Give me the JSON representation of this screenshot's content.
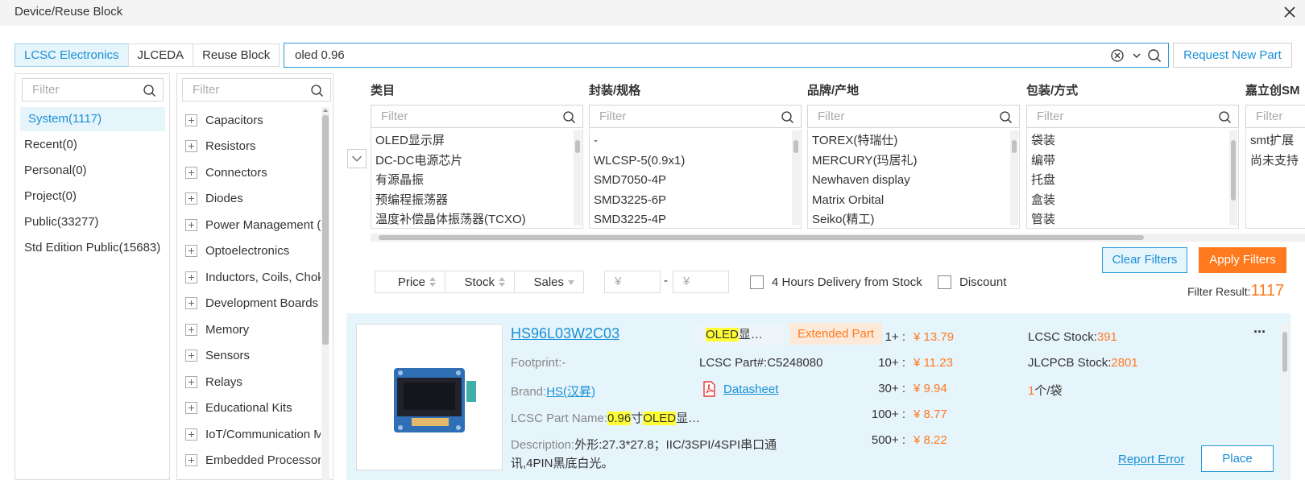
{
  "window": {
    "title": "Device/Reuse Block"
  },
  "source_tabs": [
    "LCSC Electronics",
    "JLCEDA",
    "Reuse Block"
  ],
  "search": {
    "value": "oled 0.96"
  },
  "request_new_part": "Request New Part",
  "filter_placeholder": "Filter",
  "libraries": [
    "System(1117)",
    "Recent(0)",
    "Personal(0)",
    "Project(0)",
    "Public(33277)",
    "Std Edition Public(15683)"
  ],
  "categories": [
    "Capacitors",
    "Resistors",
    "Connectors",
    "Diodes",
    "Power Management (P",
    "Optoelectronics",
    "Inductors, Coils, Chok",
    "Development Boards &",
    "Memory",
    "Sensors",
    "Relays",
    "Educational Kits",
    "IoT/Communication M",
    "Embedded Processors"
  ],
  "facets": [
    {
      "title": "类目",
      "items": [
        "OLED显示屏",
        "DC-DC电源芯片",
        "有源晶振",
        "预编程振荡器",
        "温度补偿晶体振荡器(TCXO)"
      ]
    },
    {
      "title": "封装/规格",
      "items": [
        "-",
        "WLCSP-5(0.9x1)",
        "SMD7050-4P",
        "SMD3225-6P",
        "SMD3225-4P"
      ]
    },
    {
      "title": "品牌/产地",
      "items": [
        "TOREX(特瑞仕)",
        "MERCURY(玛居礼)",
        "Newhaven display",
        "Matrix Orbital",
        "Seiko(精工)"
      ]
    },
    {
      "title": "包装/方式",
      "items": [
        "袋装",
        "编带",
        "托盘",
        "盒装",
        "管装"
      ]
    },
    {
      "title": "嘉立创SM",
      "items": [
        "smt扩展",
        "尚未支持"
      ]
    }
  ],
  "buttons": {
    "clear_filters": "Clear Filters",
    "apply_filters": "Apply Filters"
  },
  "sort": {
    "price": "Price",
    "stock": "Stock",
    "sales": "Sales"
  },
  "price_range": {
    "min_placeholder": "¥",
    "max_placeholder": "¥",
    "dash": "-"
  },
  "checkboxes": {
    "four_hours": "4 Hours Delivery from Stock",
    "discount": "Discount"
  },
  "filter_result": {
    "label": "Filter Result:",
    "count": "1117"
  },
  "part": {
    "number": "HS96L03W2C03",
    "category_hl": "OLED",
    "category_rest": "显…",
    "tag": "Extended Part",
    "footprint_label": "Footprint:",
    "footprint": "-",
    "lcsc_part_label": "LCSC Part#:",
    "lcsc_part": "C5248080",
    "brand_label": "Brand:",
    "brand": "HS(汉昇)",
    "datasheet": "Datasheet",
    "name_label": "LCSC Part Name:",
    "name_hl1": "0.96",
    "name_mid": "寸",
    "name_hl2": "OLED",
    "name_rest": "显…",
    "desc_label": "Description:",
    "desc_line1": "外形:27.3*27.8；IIC/3SPI/4SPI串口通",
    "desc_line2": "讯,4PIN黑底白光。",
    "prices": [
      {
        "qty": "1+ :",
        "price": "¥ 13.79"
      },
      {
        "qty": "10+ :",
        "price": "¥ 11.23"
      },
      {
        "qty": "30+ :",
        "price": "¥ 9.94"
      },
      {
        "qty": "100+ :",
        "price": "¥ 8.77"
      },
      {
        "qty": "500+ :",
        "price": "¥ 8.22"
      }
    ],
    "lcsc_stock_label": "LCSC Stock:",
    "lcsc_stock": "391",
    "jlcpcb_stock_label": "JLCPCB Stock:",
    "jlcpcb_stock": "2801",
    "pack_qty": "1",
    "pack_unit": "个/袋",
    "report_error": "Report Error",
    "place": "Place",
    "more": "···"
  },
  "colors": {
    "accent": "#1890d5",
    "orange": "#ff7a1f",
    "selected_bg": "#e6f4fc",
    "highlight": "#ffff33"
  }
}
